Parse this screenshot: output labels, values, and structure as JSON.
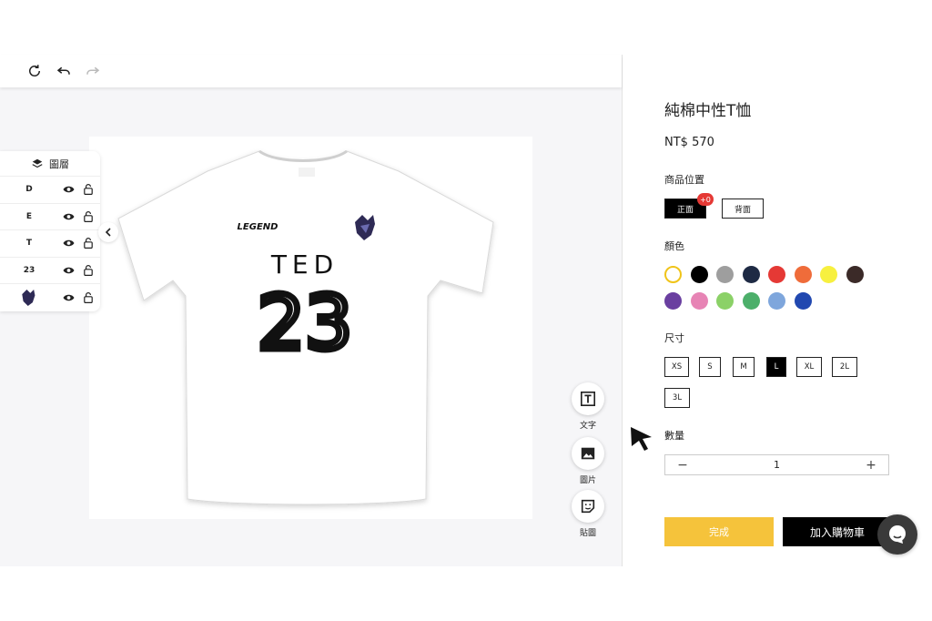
{
  "editor": {
    "toolbar": {
      "refresh_icon": "refresh-icon",
      "undo_icon": "undo-icon",
      "redo_icon": "redo-icon"
    },
    "layers_panel": {
      "title": "圖層",
      "items": [
        {
          "label": "D"
        },
        {
          "label": "E"
        },
        {
          "label": "T"
        },
        {
          "label": "23"
        },
        {
          "label": "",
          "thumbnail": "logo-thumbnail"
        }
      ]
    },
    "design": {
      "badge_text": "LEGEND",
      "name_text": "TED",
      "number_text": "23",
      "shirt_color": "#ffffff"
    },
    "tools": [
      {
        "label": "文字",
        "icon": "text-tool-icon"
      },
      {
        "label": "圖片",
        "icon": "image-tool-icon"
      },
      {
        "label": "貼圖",
        "icon": "sticker-tool-icon"
      }
    ]
  },
  "product": {
    "title": "純棉中性T恤",
    "price": "NT$ 570",
    "position_label": "商品位置",
    "positions": [
      {
        "label": "正面",
        "active": true,
        "badge": "+0"
      },
      {
        "label": "背面",
        "active": false
      }
    ],
    "color_label": "顏色",
    "colors": [
      "#ffffff",
      "#000000",
      "#9e9e9e",
      "#1e2a44",
      "#e53935",
      "#ef6c3a",
      "#f7f03f",
      "#3b2a28",
      "#6a3fa0",
      "#e784b5",
      "#8bd167",
      "#4caf6a",
      "#7ea6dc",
      "#2148b0"
    ],
    "selected_color": "#ffffff",
    "accent_color": "#f0c419",
    "size_label": "尺寸",
    "sizes": [
      {
        "label": "XS",
        "active": false
      },
      {
        "label": "S",
        "active": false
      },
      {
        "label": "M",
        "active": false
      },
      {
        "label": "L",
        "active": true
      },
      {
        "label": "XL",
        "active": false
      },
      {
        "label": "2L",
        "active": false
      },
      {
        "label": "3L",
        "active": false
      }
    ],
    "quantity_label": "數量",
    "quantity": "1",
    "minus": "−",
    "plus": "+",
    "done_label": "完成",
    "cart_label": "加入購物車"
  }
}
